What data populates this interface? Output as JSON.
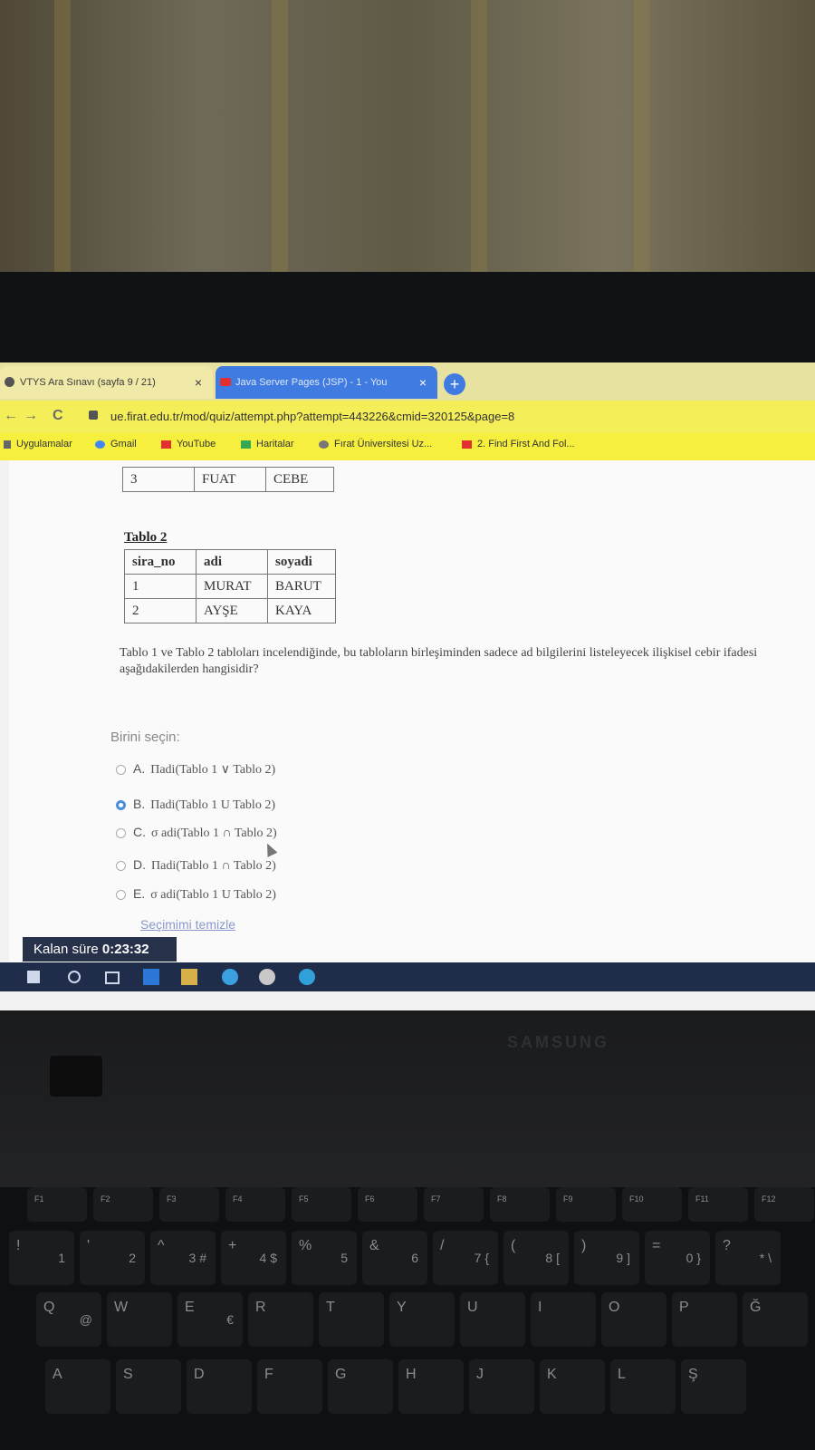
{
  "browser": {
    "tabs": [
      {
        "title": "VTYS Ara Sınavı (sayfa 9 / 21)",
        "close": "×"
      },
      {
        "title": "Java Server Pages (JSP) - 1 - You",
        "close": "×"
      }
    ],
    "new_tab": "+",
    "nav": {
      "back": "←",
      "forward": "→",
      "reload": "C"
    },
    "url": "ue.firat.edu.tr/mod/quiz/attempt.php?attempt=443226&cmid=320125&page=8",
    "bookmarks": [
      "Uygulamalar",
      "Gmail",
      "YouTube",
      "Haritalar",
      "Fırat Üniversitesi Uz...",
      "2. Find First And Fol..."
    ]
  },
  "tablo1_partial": {
    "rows": [
      [
        "3",
        "FUAT",
        "CEBE"
      ]
    ]
  },
  "tablo2": {
    "caption": "Tablo 2",
    "headers": [
      "sira_no",
      "adi",
      "soyadi"
    ],
    "rows": [
      [
        "1",
        "MURAT",
        "BARUT"
      ],
      [
        "2",
        "AYŞE",
        "KAYA"
      ]
    ]
  },
  "question": {
    "text": "Tablo 1 ve Tablo 2 tabloları incelendiğinde, bu tabloların birleşiminden sadece ad bilgilerini listeleyecek ilişkisel cebir ifadesi aşağıdakilerden hangisidir?",
    "choose_label": "Birini seçin:",
    "options": [
      {
        "letter": "A.",
        "text": "Πadi(Tablo 1 ∨ Tablo 2)",
        "selected": false
      },
      {
        "letter": "B.",
        "text": "Πadi(Tablo 1 U Tablo 2)",
        "selected": true
      },
      {
        "letter": "C.",
        "text": "σ adi(Tablo 1 ∩ Tablo 2)",
        "selected": false
      },
      {
        "letter": "D.",
        "text": "Πadi(Tablo 1 ∩ Tablo 2)",
        "selected": false
      },
      {
        "letter": "E.",
        "text": "σ adi(Tablo 1 U Tablo 2)",
        "selected": false
      }
    ],
    "clear_label": "Seçimimi temizle"
  },
  "timer": {
    "label": "Kalan süre",
    "value": "0:23:32"
  },
  "laptop": {
    "brand": "SAMSUNG"
  },
  "keyboard": {
    "fkeys": [
      "F1",
      "F2",
      "F3",
      "F4",
      "F5",
      "F6",
      "F7",
      "F8",
      "F9",
      "F10",
      "F11",
      "F12"
    ],
    "numrow": [
      [
        "!",
        "1"
      ],
      [
        "'",
        "2"
      ],
      [
        "^",
        "3 #"
      ],
      [
        "+",
        "4 $"
      ],
      [
        "%",
        "5"
      ],
      [
        "&",
        "6"
      ],
      [
        "/",
        "7 {"
      ],
      [
        "(",
        "8 ["
      ],
      [
        ")",
        "9 ]"
      ],
      [
        "=",
        "0 }"
      ],
      [
        "?",
        "* \\"
      ]
    ],
    "qrow": [
      "Q",
      "W",
      "E",
      "R",
      "T",
      "Y",
      "U",
      "I",
      "O",
      "P",
      "Ğ"
    ],
    "arow": [
      "A",
      "S",
      "D",
      "F",
      "G",
      "H",
      "J",
      "K",
      "L",
      "Ş"
    ],
    "extra": [
      "@",
      "€"
    ]
  },
  "colors": {
    "accent_blue": "#3f7be0",
    "bookmark_yellow": "#f6ef3e",
    "timer_bg": "#27324a"
  }
}
